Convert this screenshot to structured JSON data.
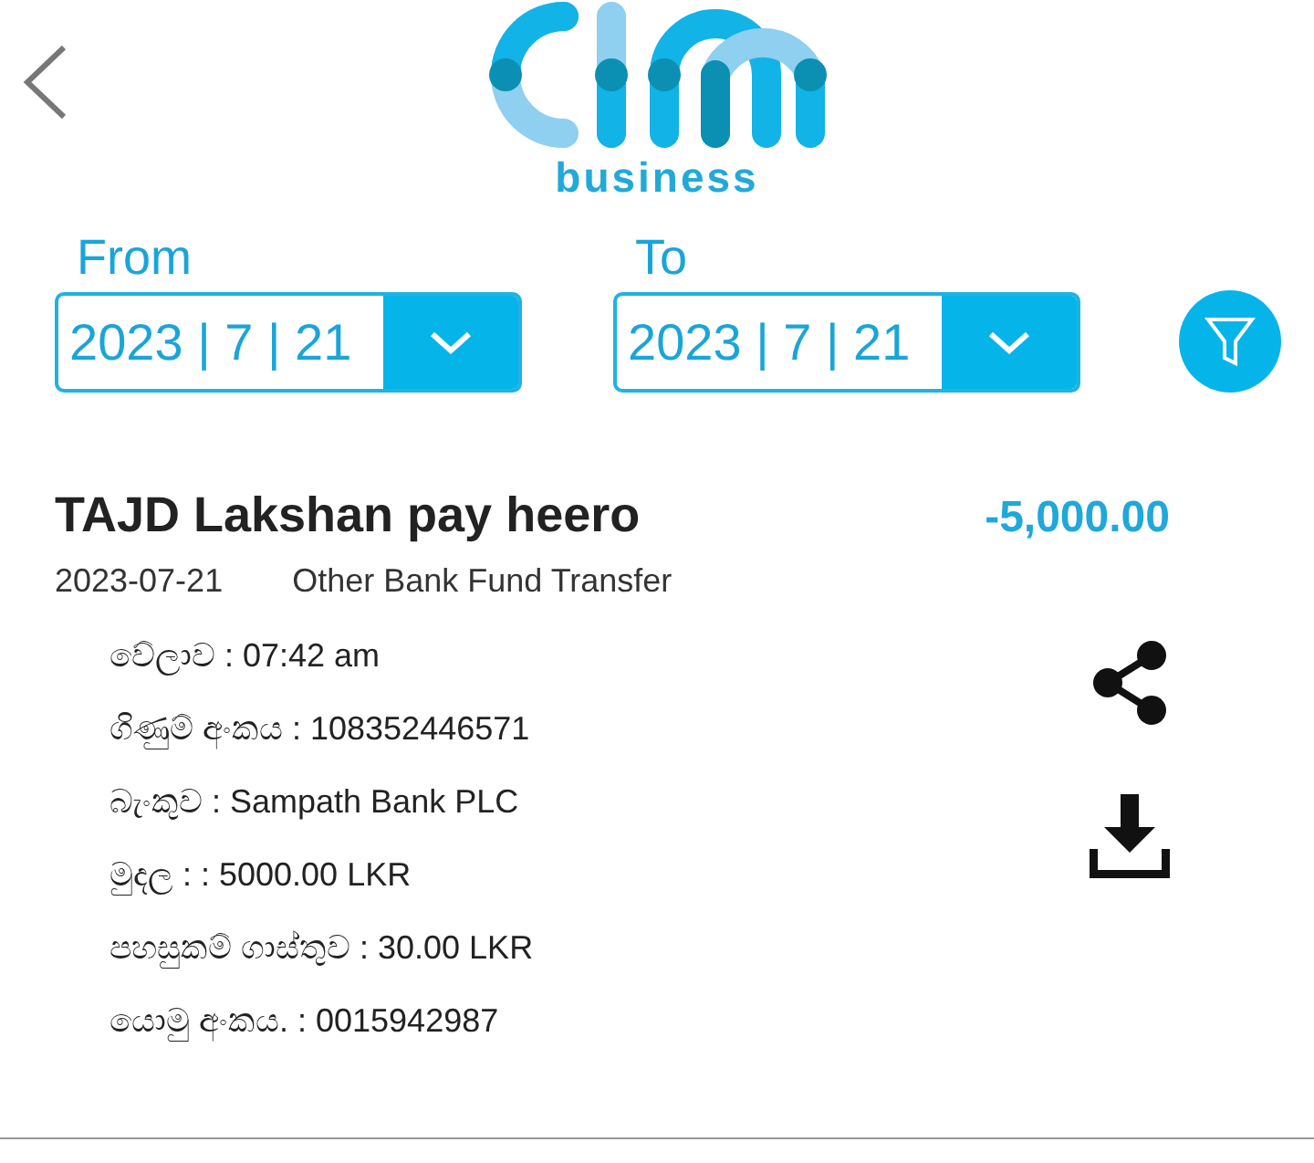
{
  "header": {
    "brand_subtitle": "business"
  },
  "date_filters": [
    {
      "label": "From",
      "value": "2023 | 7 | 21"
    },
    {
      "label": "To",
      "value": "2023 | 7 | 21"
    }
  ],
  "transaction": {
    "title": "TAJD Lakshan pay heero",
    "amount": "-5,000.00",
    "date": "2023-07-21",
    "type": "Other Bank Fund Transfer",
    "details": [
      "වේලාව  : 07:42 am",
      "ගිණුම් අංකය  : 108352446571",
      "බැංකුව  : Sampath Bank PLC",
      "මුදල : : 5000.00 LKR",
      "පහසුකම් ගාස්තුව : 30.00 LKR",
      "යොමු අංකය.  : 0015942987"
    ]
  }
}
